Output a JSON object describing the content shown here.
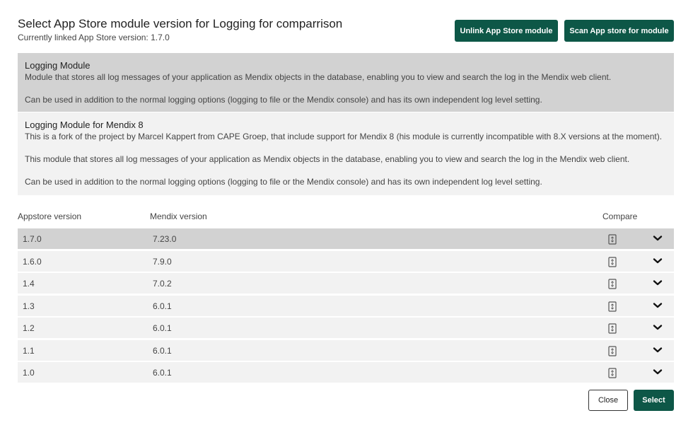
{
  "header": {
    "title": "Select App Store module version for Logging for comparrison",
    "subtitle": "Currently linked App Store version: 1.7.0"
  },
  "toolbar": {
    "unlink_label": "Unlink App Store module",
    "scan_label": "Scan App store for module"
  },
  "modules": [
    {
      "name": "Logging Module",
      "paragraphs": [
        "Module that stores all log messages of your application as Mendix objects in the database, enabling you to view and search the log in the Mendix web client.",
        "Can be used in addition to the normal logging options (logging to file or the Mendix console) and has its own independent log level setting."
      ]
    },
    {
      "name": "Logging Module for Mendix 8",
      "paragraphs": [
        "This is a fork of the project by Marcel Kappert from CAPE Groep, that include support for Mendix 8 (his module is currently incompatible with 8.X versions at the moment).",
        "This module that stores all log messages of your application as Mendix objects in the database, enabling you to view and search the log in the Mendix web client.",
        "Can be used in addition to the normal logging options (logging to file or the Mendix console) and has its own independent log level setting."
      ]
    }
  ],
  "table": {
    "headers": {
      "appstore": "Appstore version",
      "mendix": "Mendix version",
      "compare": "Compare"
    },
    "rows": [
      {
        "appstore": "1.7.0",
        "mendix": "7.23.0"
      },
      {
        "appstore": "1.6.0",
        "mendix": "7.9.0"
      },
      {
        "appstore": "1.4",
        "mendix": "7.0.2"
      },
      {
        "appstore": "1.3",
        "mendix": "6.0.1"
      },
      {
        "appstore": "1.2",
        "mendix": "6.0.1"
      },
      {
        "appstore": "1.1",
        "mendix": "6.0.1"
      },
      {
        "appstore": "1.0",
        "mendix": "6.0.1"
      }
    ]
  },
  "footer": {
    "close_label": "Close",
    "select_label": "Select"
  },
  "icons": {
    "compare": "document-compare-icon",
    "expand": "chevron-down-icon"
  },
  "colors": {
    "primary": "#0d5747",
    "selected_bg": "#d2d2d2",
    "row_bg": "#f2f2f2"
  }
}
